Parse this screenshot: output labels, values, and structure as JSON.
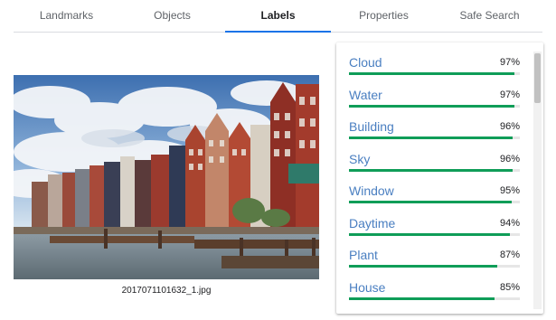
{
  "tabs": [
    {
      "label": "Landmarks",
      "active": false
    },
    {
      "label": "Objects",
      "active": false
    },
    {
      "label": "Labels",
      "active": true
    },
    {
      "label": "Properties",
      "active": false
    },
    {
      "label": "Safe Search",
      "active": false
    }
  ],
  "image": {
    "caption": "2017071101632_1.jpg"
  },
  "labels": [
    {
      "name": "Cloud",
      "percent": "97%",
      "score": 0.97
    },
    {
      "name": "Water",
      "percent": "97%",
      "score": 0.97
    },
    {
      "name": "Building",
      "percent": "96%",
      "score": 0.96
    },
    {
      "name": "Sky",
      "percent": "96%",
      "score": 0.96
    },
    {
      "name": "Window",
      "percent": "95%",
      "score": 0.95
    },
    {
      "name": "Daytime",
      "percent": "94%",
      "score": 0.94
    },
    {
      "name": "Plant",
      "percent": "87%",
      "score": 0.87
    },
    {
      "name": "House",
      "percent": "85%",
      "score": 0.85
    }
  ],
  "colors": {
    "accent": "#1a73e8",
    "label_text": "#4a7fc1",
    "bar": "#0f9d58"
  }
}
